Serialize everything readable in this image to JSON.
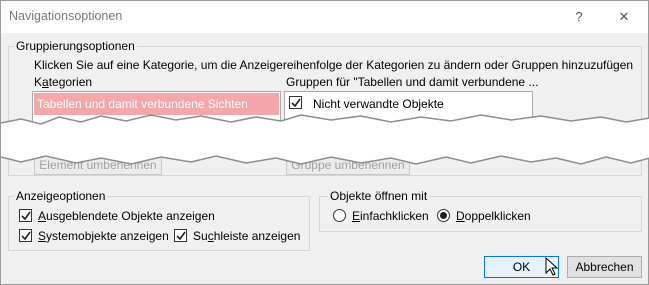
{
  "window": {
    "title": "Navigationsoptionen",
    "help_glyph": "?",
    "close_glyph": "✕"
  },
  "grouping": {
    "legend": "Gruppierungsoptionen",
    "instruction": "Klicken Sie auf eine Kategorie, um die Anzeigereihenfolge der Kategorien zu ändern oder Gruppen hinzuzufügen",
    "categories_header_prefix": "K",
    "categories_header_accel": "a",
    "categories_header_rest": "tegorien",
    "groups_header": "Gruppen für \"Tabellen und damit verbundene ...",
    "selected_category": "Tabellen und damit verbundene Sichten",
    "group_item": "Nicht verwandte Objekte",
    "group_item_checked": true,
    "rename_item_button": "Element umbenennen",
    "rename_group_button": "Gruppe umbenennen"
  },
  "display": {
    "legend": "Anzeigeoptionen",
    "hidden_objects": {
      "accel": "A",
      "rest": "usgeblendete Objekte anzeigen",
      "checked": true
    },
    "system_objects": {
      "accel": "S",
      "rest": "ystemobjekte anzeigen",
      "checked": true
    },
    "search_bar": {
      "prefix": "Su",
      "accel": "c",
      "rest": "hleiste anzeigen",
      "checked": true
    }
  },
  "open_objects": {
    "legend": "Objekte öffnen mit",
    "single_click": {
      "accel": "E",
      "rest": "infachklicken",
      "selected": false
    },
    "double_click": {
      "accel": "D",
      "rest": "oppelklicken",
      "selected": true
    }
  },
  "buttons": {
    "ok": "OK",
    "cancel": "Abbrechen"
  },
  "colors": {
    "selection": "#f4a6a8",
    "default_button_border": "#0078d7"
  }
}
